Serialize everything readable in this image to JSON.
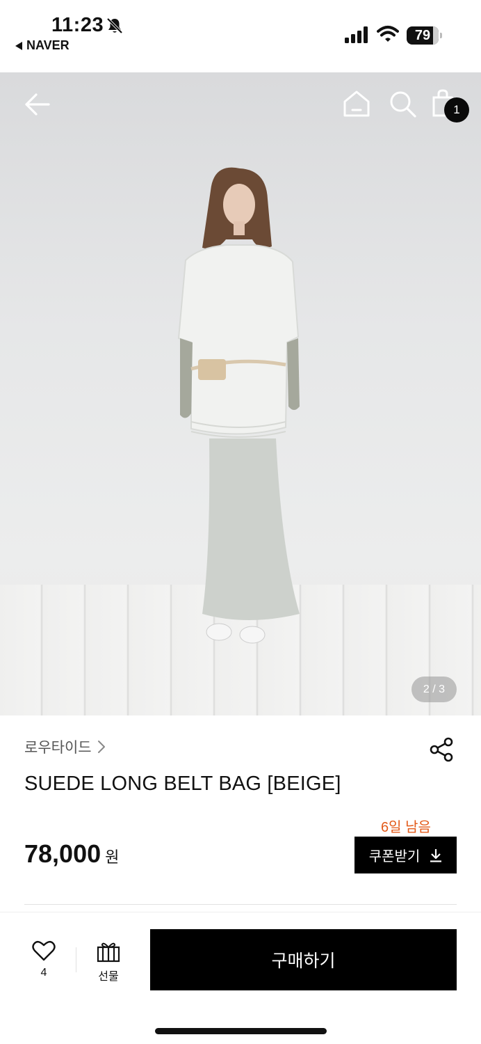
{
  "status_bar": {
    "time": "11:23",
    "back_app": "NAVER",
    "battery": "79"
  },
  "header": {
    "cart_count": "1",
    "image_pager": "2 / 3"
  },
  "product": {
    "brand": "로우타이드",
    "title": "SUEDE LONG BELT BAG [BEIGE]",
    "price": "78,000",
    "currency": "원",
    "coupon_remaining": "6일 남음",
    "coupon_button": "쿠폰받기"
  },
  "bottom_bar": {
    "like_count": "4",
    "gift_label": "선물",
    "buy_label": "구매하기"
  },
  "colors": {
    "accent": "#e35a1a",
    "primary": "#000000"
  },
  "icons": [
    "bell-slash-icon",
    "signal-icon",
    "wifi-icon",
    "back-arrow-icon",
    "home-icon",
    "search-icon",
    "shopping-bag-icon",
    "share-icon",
    "heart-icon",
    "gift-icon",
    "download-icon"
  ]
}
